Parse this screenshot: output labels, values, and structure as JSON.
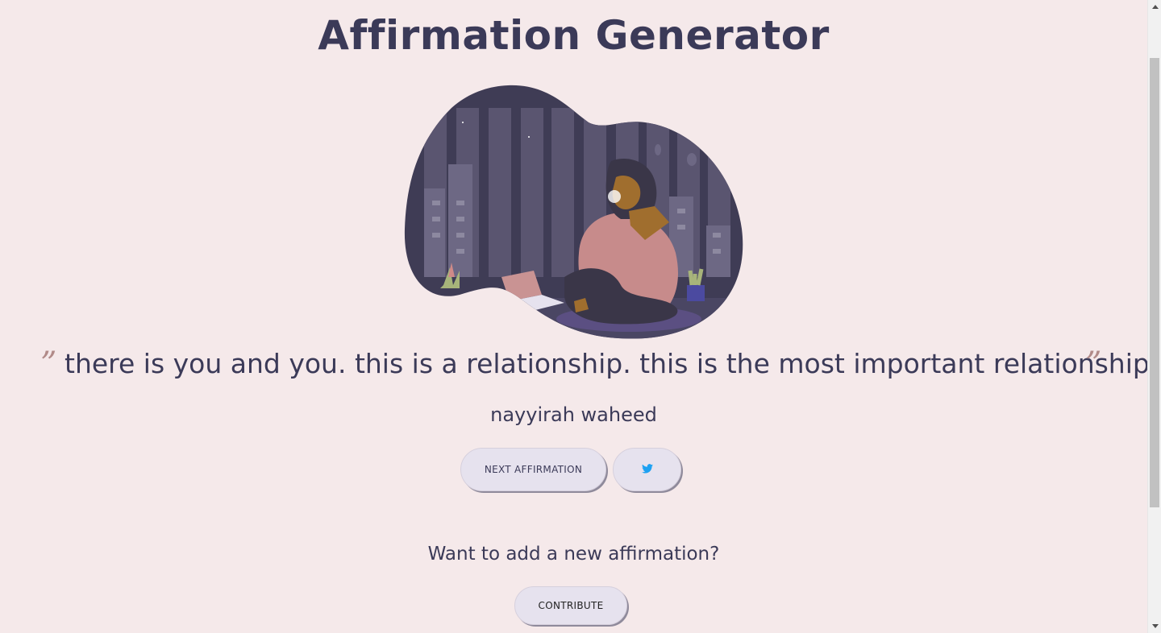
{
  "header": {
    "title": "Affirmation Generator"
  },
  "illustration": {
    "icon": "woman-on-phone-night-city-illustration"
  },
  "affirmation": {
    "open_quote": "”",
    "close_quote": "”",
    "text": "there is you and you. this is a relationship. this is the most important relationship.",
    "author": "nayyirah waheed"
  },
  "actions": {
    "next_label": "NEXT AFFIRMATION",
    "tweet_icon": "twitter-icon"
  },
  "contribute": {
    "question": "Want to add a new affirmation?",
    "button_label": "CONTRIBUTE"
  },
  "colors": {
    "background": "#f5e9ea",
    "text": "#3b3a58",
    "quote_mark": "#b18a88",
    "button_bg": "#e6e2ee",
    "twitter_blue": "#1da1f2"
  }
}
